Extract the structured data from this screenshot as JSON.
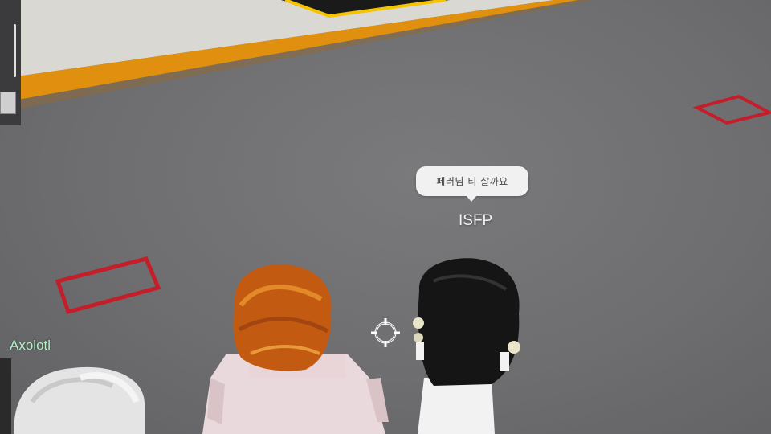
{
  "player_bubble": {
    "chat_text": "페러님 티 살까요"
  },
  "players": [
    {
      "name": "ISFP"
    },
    {
      "name": "Axolotl"
    }
  ],
  "colors": {
    "floor": "#6f6f70",
    "stage_trim": "#e0900e",
    "stage_surface": "#d9d8d3",
    "floor_marker": "#c41e2a",
    "axolotl_nametag": "#b4f0c4"
  },
  "icons": {
    "crosshair": "crosshair-icon"
  }
}
